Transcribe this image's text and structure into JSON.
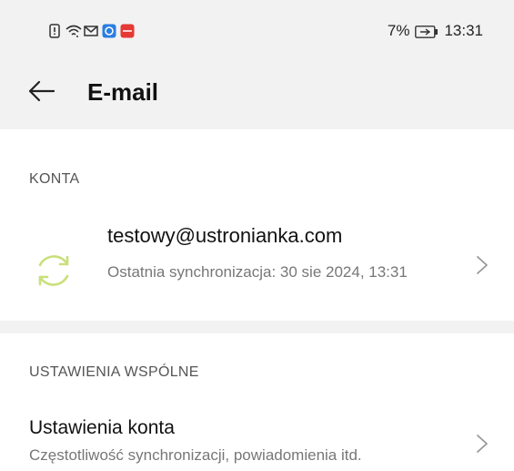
{
  "status_bar": {
    "icons": [
      "sim-alert-icon",
      "wifi-icon",
      "mail-icon",
      "app-blue-icon",
      "app-red-icon"
    ],
    "battery_percent": "7%",
    "time": "13:31"
  },
  "app_bar": {
    "title": "E-mail",
    "back_icon": "arrow-left-icon"
  },
  "sections": {
    "accounts_header": "KONTA",
    "shared_header": "USTAWIENIA WSPÓLNE"
  },
  "account": {
    "email": "testowy@ustronianka.com",
    "last_sync": "Ostatnia synchronizacja: 30 sie 2024, 13:31",
    "icon": "sync-icon",
    "accent_color": "#c9e07a"
  },
  "account_settings": {
    "title": "Ustawienia konta",
    "subtitle": "Częstotliwość synchronizacji, powiadomienia itd."
  },
  "colors": {
    "header_bg": "#f2f2f2",
    "text_secondary": "#777777",
    "app_blue": "#2a7de1",
    "app_red": "#e53935"
  }
}
